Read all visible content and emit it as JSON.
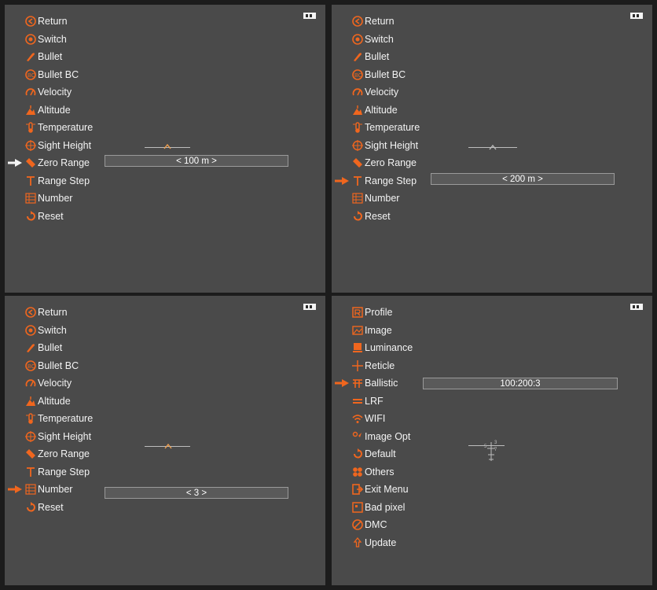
{
  "accent_color": "#f0661e",
  "menus": {
    "ballistic_submenu": [
      {
        "label": "Return",
        "icon": "return-icon"
      },
      {
        "label": "Switch",
        "icon": "switch-icon"
      },
      {
        "label": "Bullet",
        "icon": "bullet-icon"
      },
      {
        "label": "Bullet BC",
        "icon": "bullet-bc-icon"
      },
      {
        "label": "Velocity",
        "icon": "velocity-icon"
      },
      {
        "label": "Altitude",
        "icon": "altitude-icon"
      },
      {
        "label": "Temperature",
        "icon": "temperature-icon"
      },
      {
        "label": "Sight Height",
        "icon": "sight-height-icon"
      },
      {
        "label": "Zero Range",
        "icon": "zero-range-icon"
      },
      {
        "label": "Range Step",
        "icon": "range-step-icon"
      },
      {
        "label": "Number",
        "icon": "number-icon"
      },
      {
        "label": "Reset",
        "icon": "reset-icon"
      }
    ],
    "main_menu": [
      {
        "label": "Profile",
        "icon": "profile-icon"
      },
      {
        "label": "Image",
        "icon": "image-icon"
      },
      {
        "label": "Luminance",
        "icon": "luminance-icon"
      },
      {
        "label": "Reticle",
        "icon": "reticle-icon"
      },
      {
        "label": "Ballistic",
        "icon": "ballistic-icon"
      },
      {
        "label": "LRF",
        "icon": "lrf-icon"
      },
      {
        "label": "WIFI",
        "icon": "wifi-icon"
      },
      {
        "label": "Image Opt",
        "icon": "image-opt-icon"
      },
      {
        "label": "Default",
        "icon": "default-icon"
      },
      {
        "label": "Others",
        "icon": "others-icon"
      },
      {
        "label": "Exit Menu",
        "icon": "exit-menu-icon"
      },
      {
        "label": "Bad pixel",
        "icon": "bad-pixel-icon"
      },
      {
        "label": "DMC",
        "icon": "dmc-icon"
      },
      {
        "label": "Update",
        "icon": "update-icon"
      }
    ]
  },
  "panels": {
    "top_left": {
      "selected_item": "Zero Range",
      "value": "< 100 m >",
      "pointer_color": "white"
    },
    "top_right": {
      "selected_item": "Range Step",
      "value": "< 200 m >",
      "pointer_color": "orange"
    },
    "bottom_left": {
      "selected_item": "Number",
      "value": "< 3 >",
      "pointer_color": "orange"
    },
    "bottom_right": {
      "selected_item": "Ballistic",
      "value": "100:200:3",
      "pointer_color": "orange"
    }
  }
}
